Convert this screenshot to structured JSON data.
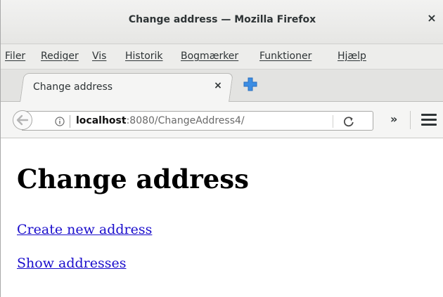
{
  "window": {
    "title": "Change address — Mozilla Firefox",
    "close_glyph": "×"
  },
  "menubar": {
    "items": [
      "Filer",
      "Rediger",
      "Vis",
      "Historik",
      "Bogmærker",
      "Funktioner",
      "Hjælp"
    ]
  },
  "tabs": [
    {
      "label": "Change address",
      "close_glyph": "×",
      "active": true
    }
  ],
  "navbar": {
    "back_icon": "back-arrow-icon",
    "info_icon": "info-icon",
    "url_host": "localhost",
    "url_rest": ":8080/ChangeAddress4/",
    "reload_icon": "reload-icon",
    "overflow_glyph": "»",
    "menu_icon": "hamburger-menu-icon"
  },
  "page": {
    "heading": "Change address",
    "links": [
      "Create new address",
      "Show addresses"
    ]
  },
  "colors": {
    "link": "#1a0dcc",
    "new_tab_plus": "#3c8de3",
    "chrome_bg": "#ededeb"
  }
}
